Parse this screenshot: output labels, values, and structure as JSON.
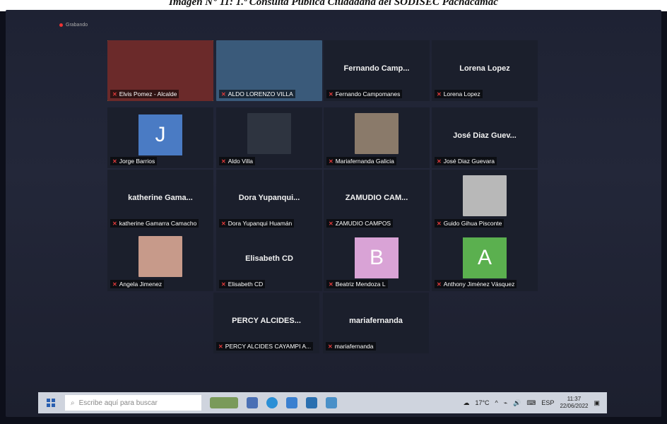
{
  "caption": "Imagen N° 11: 1.ª Consulta Pública Ciudadana del SODISEC Pachacámac",
  "recording_label": "Grabando",
  "tiles": [
    {
      "center": "",
      "name": "Elvis Pomez - Alcalde",
      "active": true
    },
    {
      "center": "",
      "name": "ALDO LORENZO VILLA"
    },
    {
      "center": "Fernando Camp...",
      "name": "Fernando Campomanes"
    },
    {
      "center": "Lorena Lopez",
      "name": "Lorena Lopez"
    },
    {
      "center": "",
      "name": "Jorge Barrios",
      "avatar": "J",
      "avatar_color": "#4a7bc4"
    },
    {
      "center": "",
      "name": "Aldo Villa"
    },
    {
      "center": "",
      "name": "Mariafernanda Galicia"
    },
    {
      "center": "José Diaz Guev...",
      "name": "José Diaz Guevara"
    },
    {
      "center": "katherine Gama...",
      "name": "katherine Gamarra Camacho"
    },
    {
      "center": "Dora Yupanqui...",
      "name": "Dora Yupanqui Huamán"
    },
    {
      "center": "ZAMUDIO CAM...",
      "name": "ZAMUDIO CAMPOS"
    },
    {
      "center": "",
      "name": "Guido Gihua Pisconte"
    },
    {
      "center": "",
      "name": "Angela Jimenez"
    },
    {
      "center": "Elisabeth CD",
      "name": "Elisabeth CD"
    },
    {
      "center": "",
      "name": "Beatriz Mendoza L",
      "avatar": "B",
      "avatar_color": "#d9a3d6"
    },
    {
      "center": "",
      "name": "Anthony Jiménez Vásquez",
      "avatar": "A",
      "avatar_color": "#5bb04f"
    },
    {
      "center": "PERCY ALCIDES...",
      "name": "PERCY ALCIDES CAYAMPI A..."
    },
    {
      "center": "mariafernanda",
      "name": "mariafernanda"
    }
  ],
  "taskbar": {
    "search_placeholder": "Escribe aquí para buscar",
    "weather": "17°C",
    "lang": "ESP",
    "time": "11:37",
    "date": "22/06/2022"
  }
}
